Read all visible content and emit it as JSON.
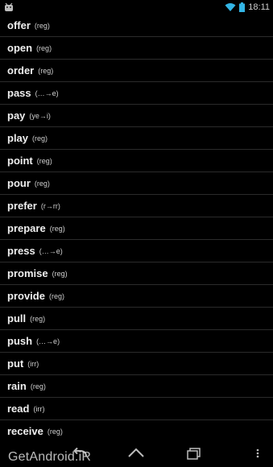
{
  "status_bar": {
    "time": "18:11",
    "left_icon": "android-icon",
    "wifi_icon": "wifi-icon",
    "battery_icon": "battery-icon"
  },
  "verbs": [
    {
      "word": "offer",
      "tag": "(reg)"
    },
    {
      "word": "open",
      "tag": "(reg)"
    },
    {
      "word": "order",
      "tag": "(reg)"
    },
    {
      "word": "pass",
      "tag": "(…→e)"
    },
    {
      "word": "pay",
      "tag": "(ye→i)"
    },
    {
      "word": "play",
      "tag": "(reg)"
    },
    {
      "word": "point",
      "tag": "(reg)"
    },
    {
      "word": "pour",
      "tag": "(reg)"
    },
    {
      "word": "prefer",
      "tag": "(r→rr)"
    },
    {
      "word": "prepare",
      "tag": "(reg)"
    },
    {
      "word": "press",
      "tag": "(…→e)"
    },
    {
      "word": "promise",
      "tag": "(reg)"
    },
    {
      "word": "provide",
      "tag": "(reg)"
    },
    {
      "word": "pull",
      "tag": "(reg)"
    },
    {
      "word": "push",
      "tag": "(…→e)"
    },
    {
      "word": "put",
      "tag": "(irr)"
    },
    {
      "word": "rain",
      "tag": "(reg)"
    },
    {
      "word": "read",
      "tag": "(irr)"
    },
    {
      "word": "receive",
      "tag": "(reg)"
    }
  ],
  "nav_bar": {
    "back_icon": "back-icon",
    "home_icon": "home-icon",
    "recents_icon": "recents-icon",
    "menu_icon": "overflow-menu-icon"
  },
  "watermark": "GetAndroid.iR",
  "colors": {
    "background": "#000000",
    "divider": "#2b2b2b",
    "text": "#efefef",
    "wifi": "#33b5e5"
  }
}
